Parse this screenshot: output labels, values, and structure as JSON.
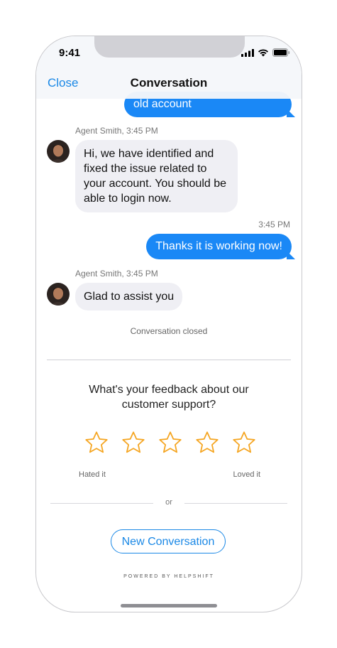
{
  "status_bar": {
    "time": "9:41",
    "icons": [
      "signal-icon",
      "wifi-icon",
      "battery-icon"
    ]
  },
  "nav": {
    "close_label": "Close",
    "title": "Conversation"
  },
  "messages": [
    {
      "direction": "outgoing",
      "text": "old account"
    },
    {
      "direction": "incoming",
      "sender": "Agent Smith, 3:45 PM",
      "text": "Hi, we have identified and fixed the issue related to your account. You should be able to login now."
    },
    {
      "direction": "outgoing",
      "timestamp": "3:45 PM",
      "text": "Thanks it is working now!"
    },
    {
      "direction": "incoming",
      "sender": "Agent Smith, 3:45 PM",
      "text": "Glad to assist you"
    }
  ],
  "conversation_status": "Conversation closed",
  "feedback": {
    "question": "What's your feedback about our customer support?",
    "star_count": 5,
    "selected_rating": 0,
    "label_low": "Hated it",
    "label_high": "Loved it"
  },
  "or_label": "or",
  "new_conversation_label": "New Conversation",
  "powered_by": "POWERED BY HELPSHIFT",
  "colors": {
    "accent": "#1a88e6",
    "outgoing_bubble": "#1a88f6",
    "incoming_bubble": "#efeff4",
    "star": "#f5a623"
  }
}
